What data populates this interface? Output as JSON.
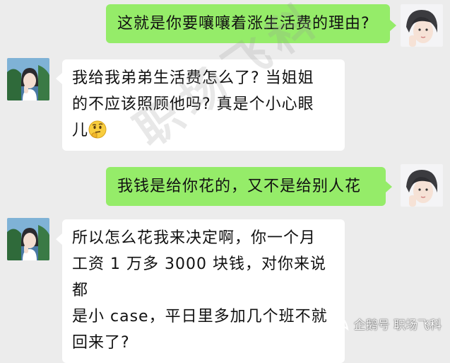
{
  "chat": {
    "messages": [
      {
        "side": "sent",
        "text": "这就是你要嚷嚷着涨生活费的理由?"
      },
      {
        "side": "received",
        "text": "我给我弟弟生活费怎么了? 当姐姐的不应该照顾他吗? 真是个小心眼儿",
        "emoji": "thinking-face"
      },
      {
        "side": "sent",
        "text": "我钱是给你花的，又不是给别人花"
      },
      {
        "side": "received",
        "text": "所以怎么花我来决定啊，你一个月工资1万多3000块钱，对你来说都是小case，平日里多加几个班不就回来了?"
      }
    ]
  },
  "lines": {
    "m1": "这就是你要嚷嚷着涨生活费的理由?",
    "m2_l1": "我给我弟弟生活费怎么了? 当姐姐",
    "m2_l2": "的不应该照顾他吗? 真是个小心眼",
    "m2_l3": "儿",
    "m3": "我钱是给你花的，又不是给别人花",
    "m4_l1": "所以怎么花我来决定啊，你一个月",
    "m4_l2": "工资 1 万多 3000 块钱，对你来说都",
    "m4_l3": "是小 case，平日里多加几个班不就",
    "m4_l4": "回来了?"
  },
  "watermark": {
    "center_text": "职场飞科",
    "bottom_text": "企鹅号 职场飞科"
  },
  "colors": {
    "background": "#ececec",
    "sent_bubble": "#95ec69",
    "received_bubble": "#ffffff"
  }
}
